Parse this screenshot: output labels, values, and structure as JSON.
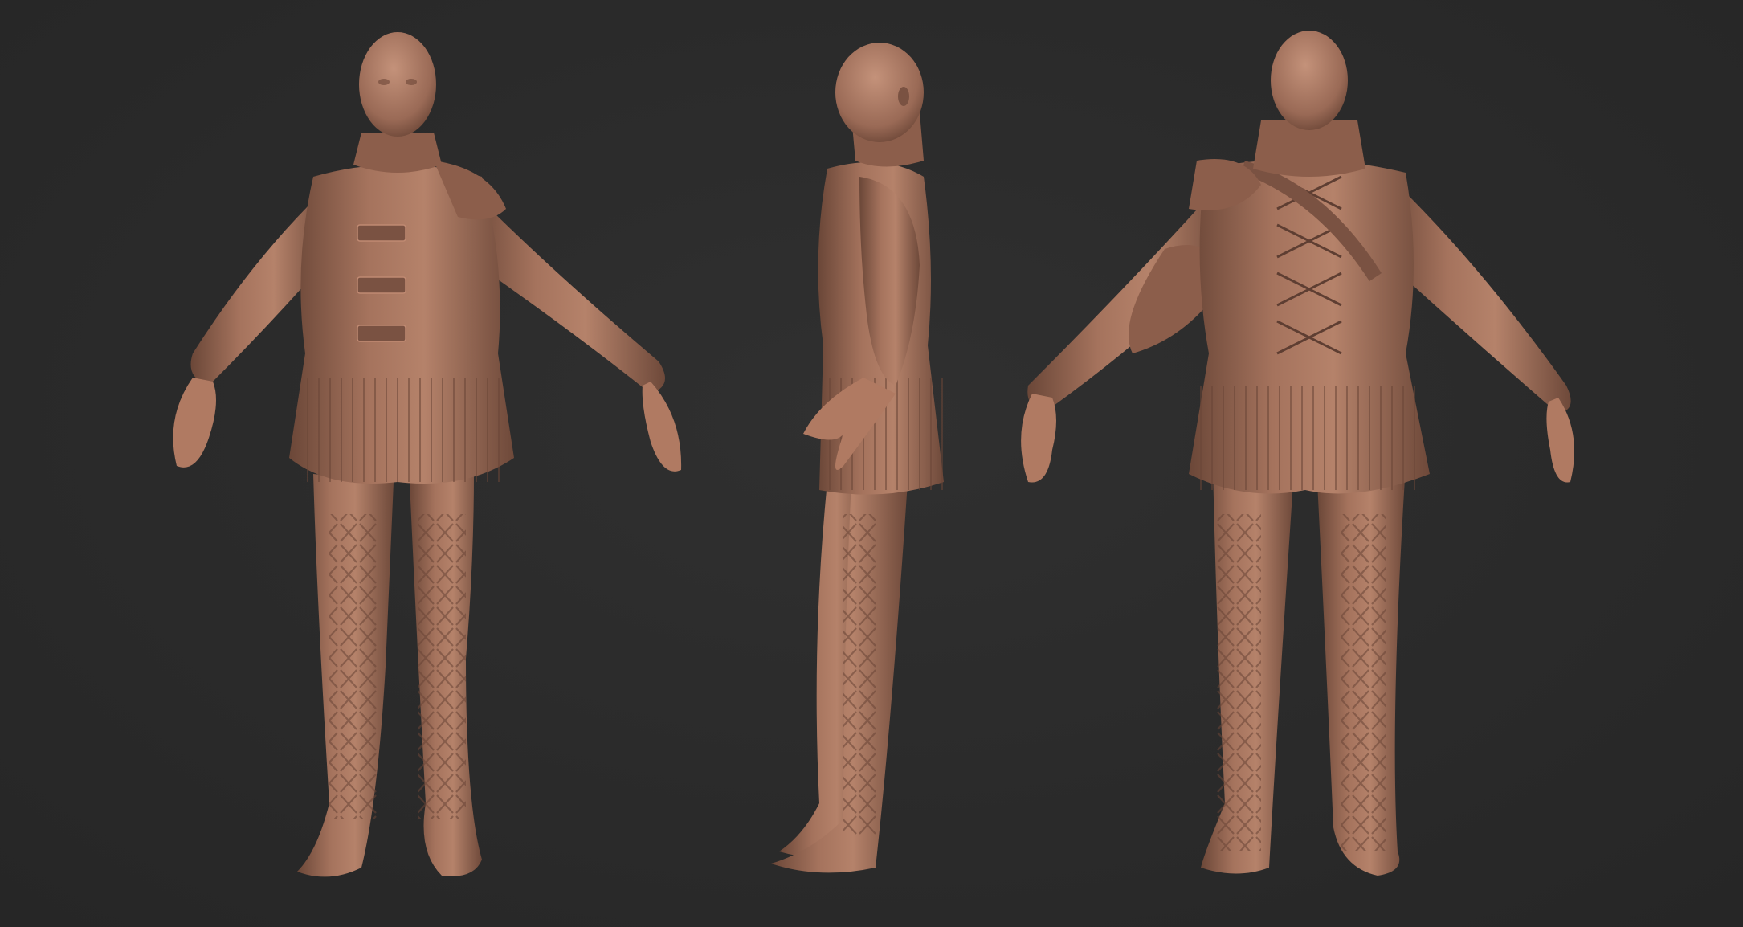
{
  "scene": {
    "background_color": "#2b2b2b",
    "clay_color": "#9a6a56",
    "clay_highlight": "#c08a72",
    "clay_shadow": "#5e3e32",
    "views": [
      {
        "id": "front",
        "angle": "front"
      },
      {
        "id": "side",
        "angle": "left-side"
      },
      {
        "id": "back",
        "angle": "back"
      }
    ]
  }
}
